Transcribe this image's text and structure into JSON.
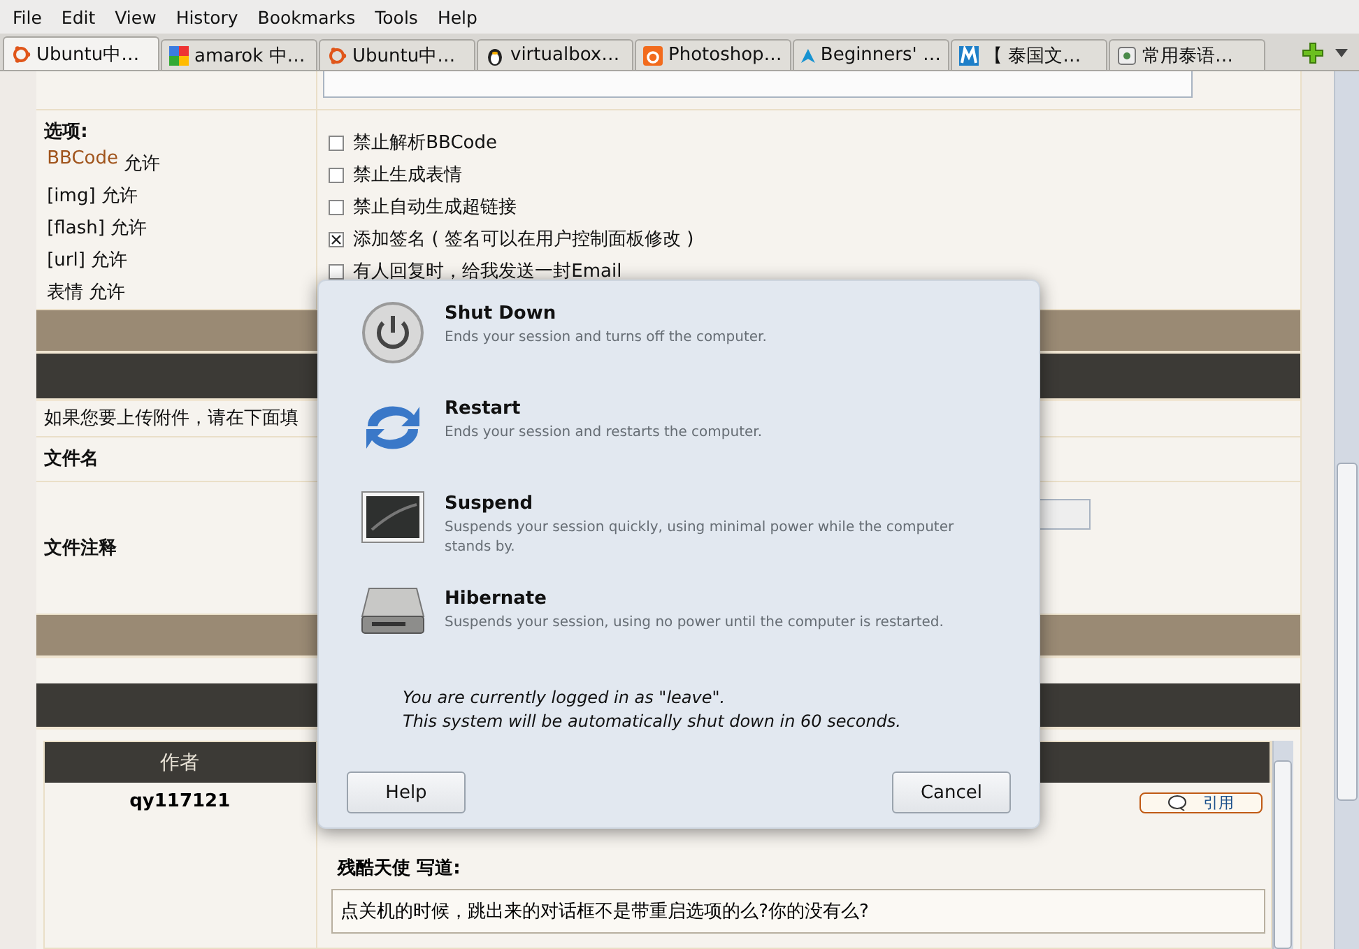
{
  "menu": [
    "File",
    "Edit",
    "View",
    "History",
    "Bookmarks",
    "Tools",
    "Help"
  ],
  "tabs": [
    {
      "label": "Ubuntu中…",
      "kind": "ubuntu",
      "selected": true
    },
    {
      "label": "amarok 中…",
      "kind": "google",
      "selected": false
    },
    {
      "label": "Ubuntu中…",
      "kind": "ubuntu",
      "selected": false
    },
    {
      "label": "virtualbox…",
      "kind": "penguin",
      "selected": false
    },
    {
      "label": "Photoshop…",
      "kind": "orange",
      "selected": false
    },
    {
      "label": "Beginners' …",
      "kind": "triangle",
      "selected": false
    },
    {
      "label": "【 泰国文…",
      "kind": "m",
      "selected": false
    },
    {
      "label": "常用泰语…",
      "kind": "page",
      "selected": false
    }
  ],
  "options": {
    "title": "选项:",
    "items": [
      {
        "label": "BBCode",
        "status": "允许",
        "link": true
      },
      {
        "label": "[img]",
        "status": "允许",
        "link": false
      },
      {
        "label": "[flash]",
        "status": "允许",
        "link": false
      },
      {
        "label": "[url]",
        "status": "允许",
        "link": false
      },
      {
        "label": "表情",
        "status": "允许",
        "link": false
      }
    ],
    "checkboxes": [
      {
        "label": "禁止解析BBCode",
        "checked": false
      },
      {
        "label": "禁止生成表情",
        "checked": false
      },
      {
        "label": "禁止自动生成超链接",
        "checked": false
      },
      {
        "label": "添加签名 ( 签名可以在用户控制面板修改 )",
        "checked": true
      },
      {
        "label": "有人回复时，给我发送一封Email",
        "checked": false
      }
    ]
  },
  "attachments": {
    "hint": "如果您要上传附件，请在下面填",
    "file_name_label": "文件名",
    "file_comment_label": "文件注释"
  },
  "posts": {
    "header": "作者",
    "author": "qy117121",
    "quote_button": "引用",
    "quote_title": "残酷天使 写道:",
    "quote_text": "点关机的时候，跳出来的对话框不是带重启选项的么?你的没有么?"
  },
  "dialog": {
    "actions": [
      {
        "kind": "power",
        "title": "Shut Down",
        "description": "Ends your session and turns off the computer."
      },
      {
        "kind": "restart",
        "title": "Restart",
        "description": "Ends your session and restarts the computer."
      },
      {
        "kind": "suspend",
        "title": "Suspend",
        "description": "Suspends your session quickly, using minimal power while the computer stands by."
      },
      {
        "kind": "hibernate",
        "title": "Hibernate",
        "description": "Suspends your session, using no power until the computer is restarted."
      }
    ],
    "notice": [
      "You are currently logged in as \"leave\".",
      "This system will be automatically shut down in 60 seconds."
    ],
    "help_button": "Help",
    "cancel_button": "Cancel"
  }
}
